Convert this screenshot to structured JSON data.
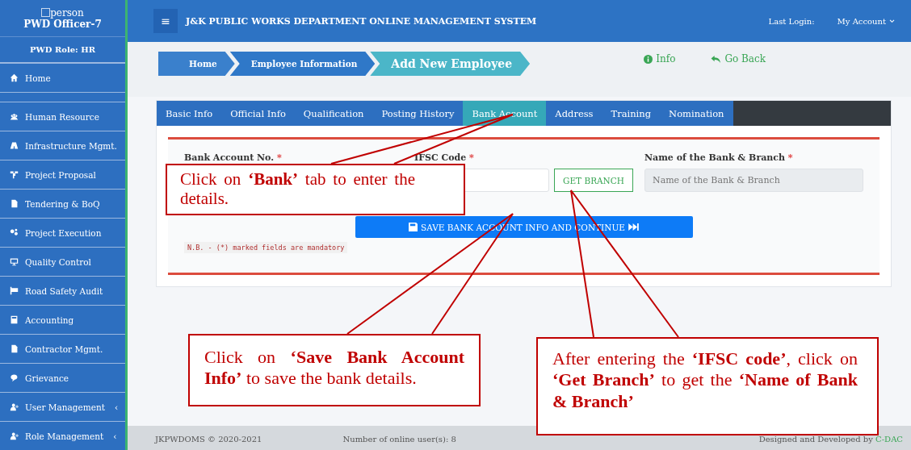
{
  "sidebar": {
    "user_icon_label": "person",
    "user": "PWD Officer-7",
    "role": "PWD Role: HR",
    "items": [
      {
        "label": "Home",
        "kind": "home"
      },
      {
        "label": "Human Resource",
        "kind": "users"
      },
      {
        "label": "Infrastructure Mgmt.",
        "kind": "road"
      },
      {
        "label": "Project Proposal",
        "kind": "tree"
      },
      {
        "label": "Tendering & BoQ",
        "kind": "file"
      },
      {
        "label": "Project Execution",
        "kind": "gears"
      },
      {
        "label": "Quality Control",
        "kind": "monitor"
      },
      {
        "label": "Road Safety Audit",
        "kind": "flag"
      },
      {
        "label": "Accounting",
        "kind": "calc"
      },
      {
        "label": "Contractor Mgmt.",
        "kind": "file"
      },
      {
        "label": "Grievance",
        "kind": "chat"
      },
      {
        "label": "User Management",
        "kind": "userplus",
        "caret": "‹"
      },
      {
        "label": "Role Management",
        "kind": "userplus",
        "caret": "‹"
      }
    ]
  },
  "header": {
    "menu_glyph": "≡",
    "title": "J&K PUBLIC WORKS DEPARTMENT ONLINE MANAGEMENT SYSTEM",
    "last_login": "Last Login:",
    "account": "My Account"
  },
  "breadcrumb": [
    {
      "label": "Home",
      "current": false
    },
    {
      "label": "Employee Information",
      "current": false
    },
    {
      "label": "Add New Employee",
      "current": true
    }
  ],
  "actions": [
    {
      "label": "Info",
      "kind": "info"
    },
    {
      "label": "Go Back",
      "kind": "back"
    }
  ],
  "tabs": [
    {
      "label": "Basic Info",
      "selected": false
    },
    {
      "label": "Official Info",
      "selected": false
    },
    {
      "label": "Qualification",
      "selected": false
    },
    {
      "label": "Posting History",
      "selected": false
    },
    {
      "label": "Bank Account",
      "selected": true
    },
    {
      "label": "Address",
      "selected": false
    },
    {
      "label": "Training",
      "selected": false
    },
    {
      "label": "Nomination",
      "selected": false
    }
  ],
  "form": {
    "fields": [
      {
        "label": "Bank Account No.",
        "required_mark": "*"
      },
      {
        "label": "IFSC Code",
        "required_mark": "*",
        "button": "GET BRANCH"
      },
      {
        "label": "Name of the Bank & Branch",
        "required_mark": "*",
        "placeholder": "Name of the Bank & Branch",
        "disabled": true
      }
    ],
    "save_button": "SAVE BANK ACCOUNT INFO AND CONTINUE",
    "note": "N.B. - (*) marked fields are mandatory"
  },
  "footer": {
    "copyright": "JKPWDOMS © 2020-2021",
    "online": "Number of online user(s): 8",
    "credit": "Designed and Developed by",
    "credit_link": "C-DAC"
  },
  "callouts": [
    {
      "text": "Click on **‘Bank’** tab to enter the details."
    },
    {
      "text": "Click on **‘Save Bank Account Info’** to save the bank details."
    },
    {
      "text": "After entering the **‘IFSC code’**, click on **‘Get Branch’** to get the **‘Name of Bank & Branch’**"
    }
  ]
}
